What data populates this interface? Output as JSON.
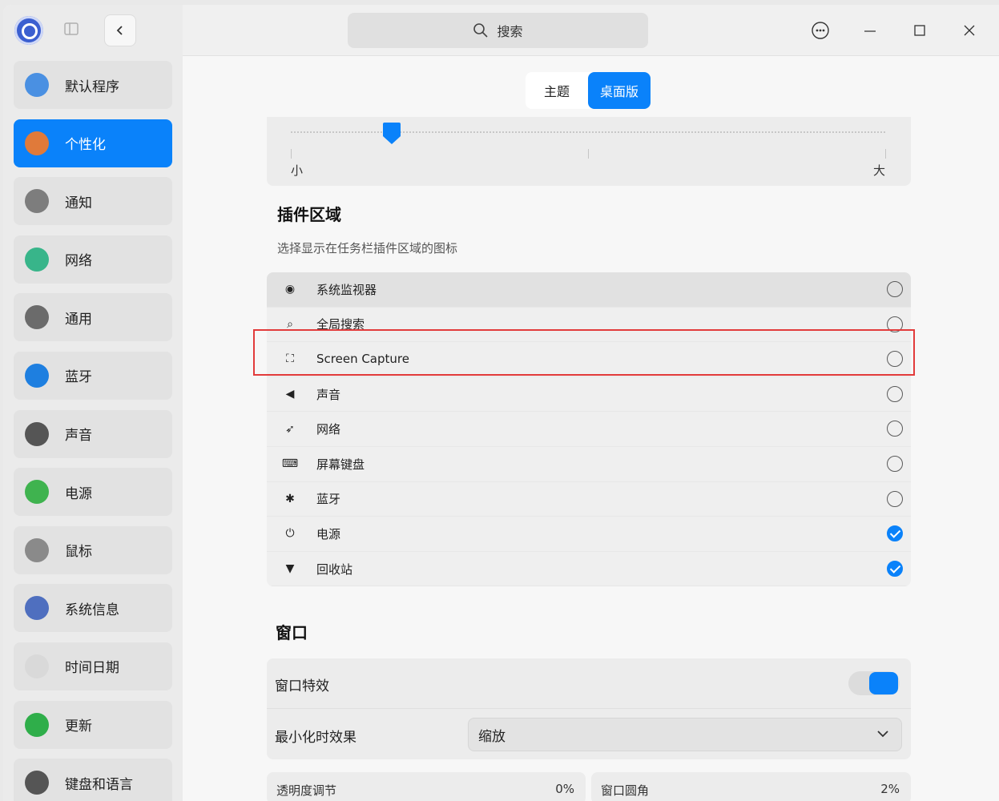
{
  "sidebar": {
    "items": [
      {
        "label": "默认程序",
        "icon": "default-apps-icon",
        "color": "#4a90e2"
      },
      {
        "label": "个性化",
        "icon": "personalization-icon",
        "color": "#e07a3a"
      },
      {
        "label": "通知",
        "icon": "bell-icon",
        "color": "#7d7d7d"
      },
      {
        "label": "网络",
        "icon": "network-globe-icon",
        "color": "#38b58a"
      },
      {
        "label": "通用",
        "icon": "gear-icon",
        "color": "#6b6b6b"
      },
      {
        "label": "蓝牙",
        "icon": "bluetooth-icon",
        "color": "#1e7fe0"
      },
      {
        "label": "声音",
        "icon": "speaker-icon",
        "color": "#555555"
      },
      {
        "label": "电源",
        "icon": "battery-icon",
        "color": "#3fb34f"
      },
      {
        "label": "鼠标",
        "icon": "mouse-icon",
        "color": "#8a8a8a"
      },
      {
        "label": "系统信息",
        "icon": "info-icon",
        "color": "#4f6fbf"
      },
      {
        "label": "时间日期",
        "icon": "clock-icon",
        "color": "#d9d9d9"
      },
      {
        "label": "更新",
        "icon": "update-arrow-icon",
        "color": "#2fae4a"
      },
      {
        "label": "键盘和语言",
        "icon": "keyboard-icon",
        "color": "#555555"
      }
    ],
    "active_index": 1
  },
  "topbar": {
    "search_placeholder": "搜索"
  },
  "tabs": {
    "theme": "主题",
    "desktop": "桌面版"
  },
  "size_slider": {
    "min_label": "小",
    "max_label": "大",
    "value_fraction": 0.17
  },
  "plugins": {
    "title": "插件区域",
    "description": "选择显示在任务栏插件区域的图标",
    "items": [
      {
        "label": "系统监视器",
        "icon": "system-monitor-icon",
        "checked": false
      },
      {
        "label": "全局搜索",
        "icon": "search-icon",
        "checked": false
      },
      {
        "label": "Screen Capture",
        "icon": "screen-capture-icon",
        "checked": false
      },
      {
        "label": "声音",
        "icon": "volume-icon",
        "checked": false
      },
      {
        "label": "网络",
        "icon": "network-icon",
        "checked": false
      },
      {
        "label": "屏幕键盘",
        "icon": "onscreen-keyboard-icon",
        "checked": false
      },
      {
        "label": "蓝牙",
        "icon": "bluetooth-icon",
        "checked": false
      },
      {
        "label": "电源",
        "icon": "power-icon",
        "checked": true
      },
      {
        "label": "回收站",
        "icon": "trash-icon",
        "checked": true
      }
    ]
  },
  "window": {
    "title": "窗口",
    "effects_label": "窗口特效",
    "effects_on": true,
    "minimize_label": "最小化时效果",
    "minimize_value": "缩放",
    "opacity_label": "透明度调节",
    "opacity_value": "0%",
    "radius_label": "窗口圆角",
    "radius_value": "2%"
  },
  "colors": {
    "accent": "#0a82fa",
    "highlight": "#e23b3b"
  }
}
